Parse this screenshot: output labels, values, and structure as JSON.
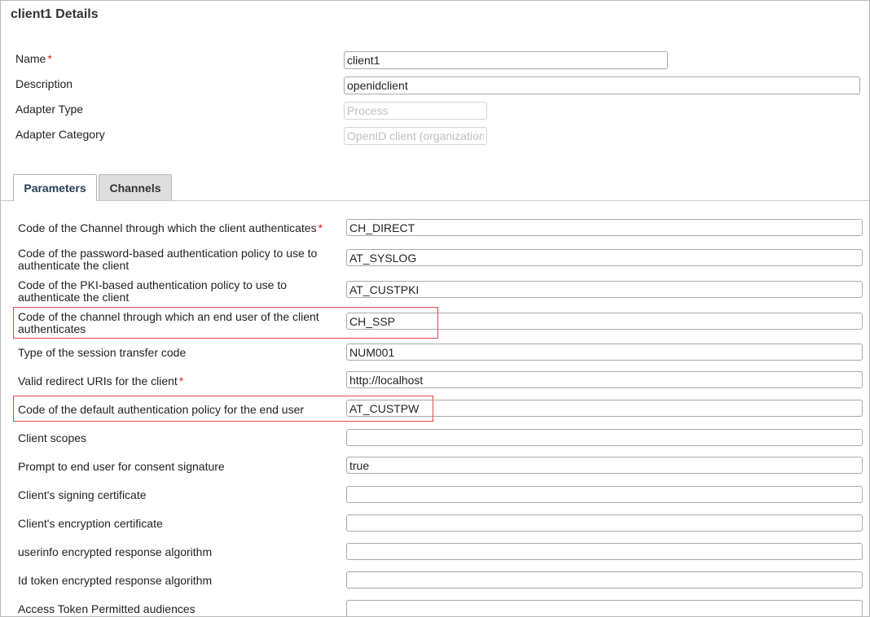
{
  "page": {
    "title": "client1 Details"
  },
  "details": {
    "name_label": "Name",
    "name_value": "client1",
    "description_label": "Description",
    "description_value": "openidclient",
    "adapter_type_label": "Adapter Type",
    "adapter_type_value": "Process",
    "adapter_category_label": "Adapter Category",
    "adapter_category_value": "OpenID client (organization)"
  },
  "required_marker": "*",
  "tabs": [
    {
      "label": "Parameters",
      "active": true
    },
    {
      "label": "Channels",
      "active": false
    }
  ],
  "params": [
    {
      "label": "Code of the Channel through which the client authenticates",
      "value": "CH_DIRECT"
    },
    {
      "label": "Code of the password-based authentication policy to use to authenticate the client",
      "value": "AT_SYSLOG"
    },
    {
      "label": "Code of the PKI-based authentication policy to use to authenticate the client",
      "value": "AT_CUSTPKI"
    },
    {
      "label": "Code of the channel through which an end user of the client authenticates",
      "value": "CH_SSP"
    },
    {
      "label": "Type of the session transfer code",
      "value": "NUM001"
    },
    {
      "label": "Valid redirect URIs for the client",
      "value": "http://localhost"
    },
    {
      "label": "Code of the default authentication policy for the end user",
      "value": "AT_CUSTPW"
    },
    {
      "label": "Client scopes",
      "value": ""
    },
    {
      "label": "Prompt to end user for consent signature",
      "value": "true"
    },
    {
      "label": "Client's signing certificate",
      "value": ""
    },
    {
      "label": "Client's encryption certificate",
      "value": ""
    },
    {
      "label": "userinfo encrypted response algorithm",
      "value": ""
    },
    {
      "label": "Id token encrypted response algorithm",
      "value": ""
    },
    {
      "label": "Access Token Permitted audiences",
      "value": ""
    }
  ],
  "colors": {
    "highlight": "#e0474c",
    "required": "#d9241c",
    "active_tab_text": "#27405a"
  }
}
